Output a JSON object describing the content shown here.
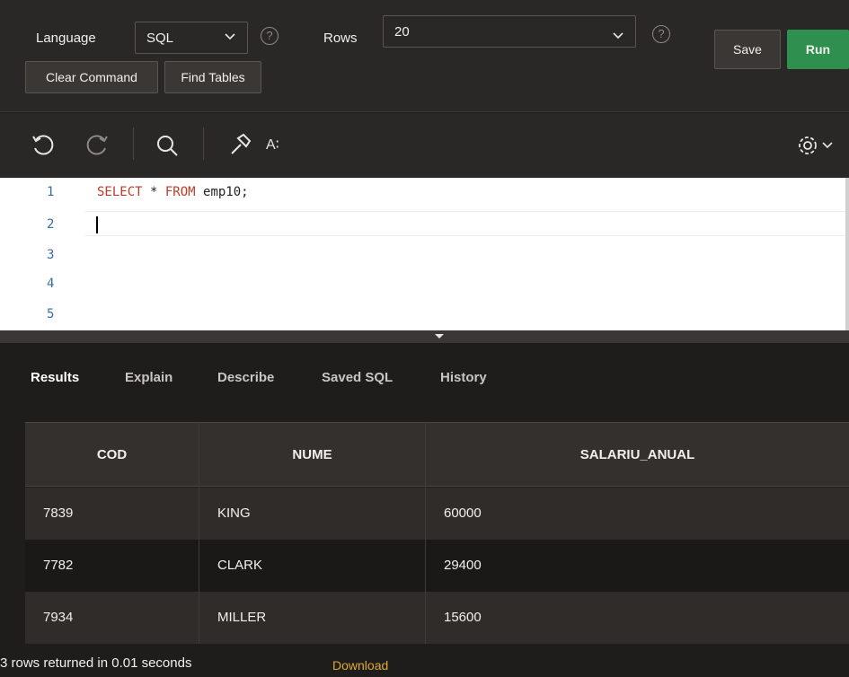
{
  "toolbar": {
    "language_label": "Language",
    "language_value": "SQL",
    "rows_label": "Rows",
    "rows_value": "20",
    "clear_label": "Clear Command",
    "find_label": "Find Tables",
    "save_label": "Save",
    "run_label": "Run",
    "help_glyph": "?"
  },
  "editor_tools": {
    "undo_icon": "undo-icon",
    "redo_icon": "redo-icon",
    "search_icon": "search-icon",
    "format_icon": "hammer-icon",
    "autocomplete_label": "A∶",
    "settings_icon": "gear-icon"
  },
  "editor": {
    "line_numbers": [
      "1",
      "2",
      "3",
      "4",
      "5"
    ],
    "code_keyword1": "SELECT",
    "code_star": " * ",
    "code_keyword2": "FROM",
    "code_rest": " emp10;"
  },
  "tabs": [
    "Results",
    "Explain",
    "Describe",
    "Saved SQL",
    "History"
  ],
  "results": {
    "columns": [
      "COD",
      "NUME",
      "SALARIU_ANUAL"
    ],
    "rows": [
      [
        "7839",
        "KING",
        "60000"
      ],
      [
        "7782",
        "CLARK",
        "29400"
      ],
      [
        "7934",
        "MILLER",
        "15600"
      ]
    ],
    "status": "3 rows returned in 0.01 seconds",
    "download_label": "Download"
  },
  "colors": {
    "run_button": "#2e8f4e",
    "download_link": "#e0a832",
    "keyword": "#c0392b",
    "line_number": "#3a6ea5"
  }
}
